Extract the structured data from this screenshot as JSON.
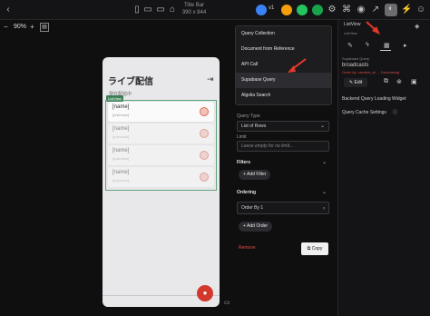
{
  "topbar": {
    "title_line1": "Title Bar",
    "title_line2": "390 x 844",
    "version_label": "v1",
    "icons": [
      "back-icon",
      "phone-icon",
      "tablet-icon",
      "desktop-icon",
      "cloud-icon",
      "firebase-icon",
      "supabase-icon",
      "check-icon",
      "settings-icon",
      "api-icon",
      "github-icon",
      "share-icon",
      "preview-icon",
      "run-icon",
      "user-icon"
    ]
  },
  "zoom": {
    "minus": "−",
    "value": "90%",
    "plus": "+"
  },
  "phone": {
    "title": "ライブ配信",
    "subtitle": "現在配信中",
    "list_tag": "ListView",
    "cards": [
      {
        "name": "[name]",
        "sub": "[unknown]"
      },
      {
        "name": "[name]",
        "sub": "[unknown]"
      },
      {
        "name": "[name]",
        "sub": "[unknown]"
      },
      {
        "name": "[name]",
        "sub": "[unknown]"
      }
    ]
  },
  "menu": {
    "items": [
      {
        "label": "Query Collection"
      },
      {
        "label": "Document from Reference"
      },
      {
        "label": "API Call"
      },
      {
        "label": "Supabase Query"
      },
      {
        "label": "Algolia Search"
      }
    ]
  },
  "query_panel": {
    "query_type_label": "Query Type",
    "query_type_value": "List of Rows",
    "limit_label": "Limit",
    "limit_placeholder": "Leave empty for no limit...",
    "filters_label": "Filters",
    "add_filter": "+ Add Filter",
    "ordering_label": "Ordering",
    "order_by_value": "Order By 1",
    "add_order": "+ Add Order",
    "remove": "Remove",
    "copy": "Copy"
  },
  "properties": {
    "widget_name": "ListView",
    "widget_type": "ListView",
    "supabase_query_label": "Supabase Query",
    "table_name": "broadcasts",
    "order_desc": "Order by: created_at → Decreasing",
    "edit_label": "Edit",
    "backend_widget_label": "Backend Query Loading Widget",
    "cache_label": "Query Cache Settings"
  },
  "colors": {
    "accent_red": "#e24b42",
    "fab_red": "#d3382c",
    "tag_green": "#3d7d55"
  }
}
